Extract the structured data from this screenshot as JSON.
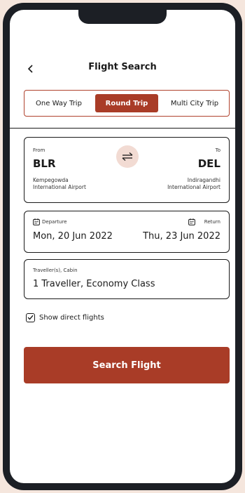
{
  "header": {
    "title": "Flight Search"
  },
  "trip_types": [
    {
      "label": "One Way Trip",
      "active": false
    },
    {
      "label": "Round Trip",
      "active": true
    },
    {
      "label": "Multi City Trip",
      "active": false
    }
  ],
  "route": {
    "from_label": "From",
    "from_code": "BLR",
    "from_airport_line1": "Kempegowda",
    "from_airport_line2": "International Airport",
    "to_label": "To",
    "to_code": "DEL",
    "to_airport_line1": "Indiragandhi",
    "to_airport_line2": "International Airport"
  },
  "dates": {
    "departure_label": "Departure",
    "departure_value": "Mon, 20 Jun 2022",
    "return_label": "Return",
    "return_value": "Thu, 23 Jun 2022"
  },
  "traveller": {
    "label": "Traveller(s), Cabin",
    "value": "1 Traveller, Economy Class"
  },
  "direct_flights": {
    "label": "Show direct flights",
    "checked": true
  },
  "search_button": {
    "label": "Search Flight"
  },
  "colors": {
    "accent": "#a93c27",
    "swap_bg": "#f2dbd3",
    "frame": "#1c1f25",
    "background": "#f5e6dd"
  },
  "icons": {
    "back": "chevron-left-icon",
    "swap": "swap-arrows-icon",
    "calendar": "calendar-icon",
    "check": "check-icon"
  }
}
